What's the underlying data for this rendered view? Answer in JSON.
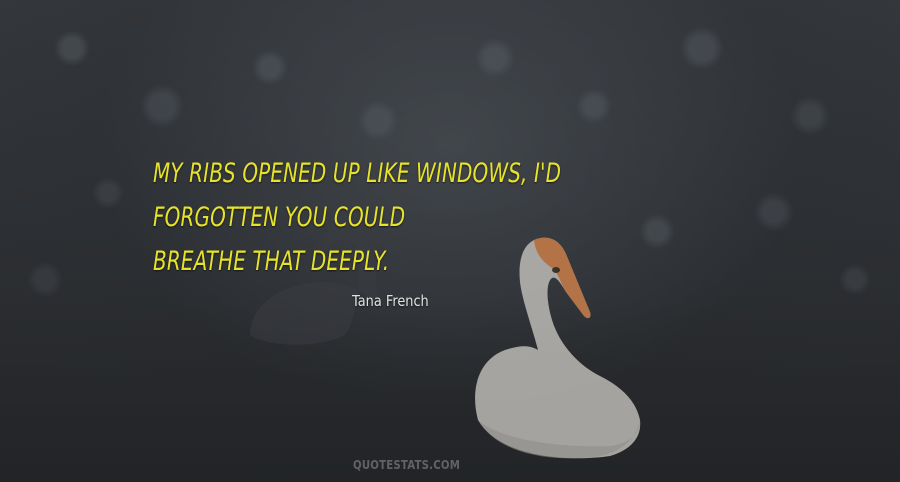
{
  "quote": {
    "line1": "My ribs opened up like windows, I'd forgotten you could",
    "line2": "breathe that deeply."
  },
  "author": "Tana French",
  "watermark": "QUOTESTATS.COM",
  "colors": {
    "quote_text": "#e7e32a",
    "author_text": "#e2e2e2",
    "background": "#2b2e33"
  }
}
